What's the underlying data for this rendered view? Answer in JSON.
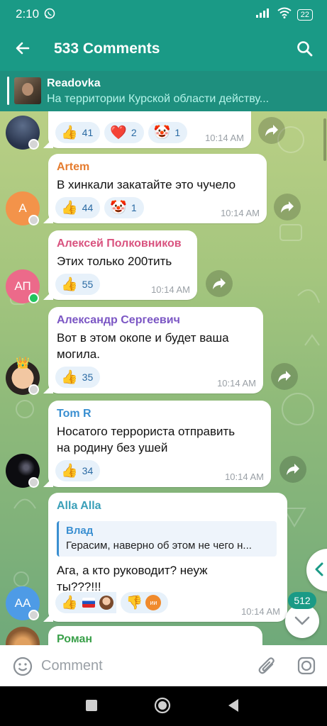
{
  "status_bar": {
    "time": "2:10",
    "battery": "22"
  },
  "header": {
    "title": "533 Comments"
  },
  "pinned": {
    "channel": "Readovka",
    "text": "На территории Курской области действу..."
  },
  "messages": [
    {
      "author": "",
      "text": "",
      "time": "10:14 AM",
      "reactions": [
        {
          "icon": "👍",
          "count": "41"
        },
        {
          "icon": "❤️",
          "count": "2"
        },
        {
          "icon": "🤡",
          "count": "1"
        }
      ]
    },
    {
      "author": "Artem",
      "author_color": "#e57c2f",
      "avatar_initials": "A",
      "avatar_color": "#f3934a",
      "text": "В хинкали закатайте это чучело",
      "time": "10:14 AM",
      "reactions": [
        {
          "icon": "👍",
          "count": "44"
        },
        {
          "icon": "🤡",
          "count": "1"
        }
      ]
    },
    {
      "author": "Алексей Полковников",
      "author_color": "#d9537f",
      "avatar_initials": "АП",
      "avatar_color": "#ec6a8a",
      "text": "Этих только 200тить",
      "time": "10:14 AM",
      "reactions": [
        {
          "icon": "👍",
          "count": "55"
        }
      ]
    },
    {
      "author": "Александр Сергеевич",
      "author_color": "#7b56c4",
      "text_lines": [
        "Вот в этом окопе и будет ваша",
        "могила."
      ],
      "time": "10:14 AM",
      "reactions": [
        {
          "icon": "👍",
          "count": "35"
        }
      ]
    },
    {
      "author": "Tom R",
      "author_color": "#3a8fd1",
      "text_lines": [
        "Носатого террориста отправить",
        "на родину без ушей"
      ],
      "time": "10:14 AM",
      "reactions": [
        {
          "icon": "👍",
          "count": "34"
        }
      ]
    },
    {
      "author": "Alla Alla",
      "author_color": "#3a9fb8",
      "avatar_initials": "АА",
      "avatar_color": "#4e9be6",
      "reply_author": "Влад",
      "reply_text": "Герасим, наверно об этом не чего н...",
      "text_lines": [
        "Ага, а кто руководит? неуж",
        "ты???!!!"
      ],
      "time": "10:14 AM",
      "reactions": [
        {
          "icon": "👍",
          "count": ""
        },
        {
          "icon": "🇷🇺",
          "count": ""
        },
        {
          "icon": "",
          "count": ""
        },
        {
          "icon": "👎",
          "count": ""
        },
        {
          "icon": "ии",
          "count": ""
        }
      ]
    },
    {
      "author": "Роман",
      "author_color": "#3aa04a"
    }
  ],
  "unread_badge": "512",
  "composer": {
    "placeholder": "Comment"
  },
  "colors": {
    "header": "#1a9a86",
    "pinned": "#1e8f7e",
    "reaction_bg": "#e7f1fa",
    "reaction_text": "#2a6aa3"
  }
}
